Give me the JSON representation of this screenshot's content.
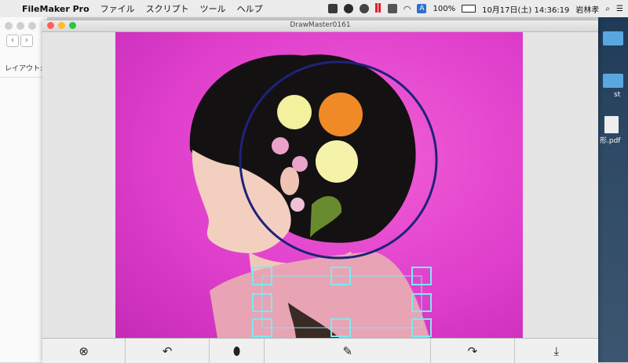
{
  "menubar": {
    "apple": "",
    "app_name": "FileMaker Pro",
    "menus": [
      "ファイル",
      "スクリプト",
      "ツール",
      "ヘルプ"
    ],
    "battery": "100%",
    "datetime": "10月17日(土)  14:36:19",
    "user": "岩林孝"
  },
  "background_window": {
    "layout_label": "レイアウト:"
  },
  "desktop": {
    "file_label_1": "st",
    "file_label_2": "形.pdf"
  },
  "window": {
    "title": "DrawMaster0161"
  },
  "toolbar": {
    "clear_icon": "⊗",
    "undo_icon": "↶",
    "ink_icon": "⬮",
    "pen_icon": "✎",
    "redo_icon": "↷",
    "save_icon": "⤓"
  },
  "colors": {
    "background_pink": "#e040cc",
    "circle_stroke": "#1d237a",
    "selection_handles": "#7fe8f0"
  }
}
